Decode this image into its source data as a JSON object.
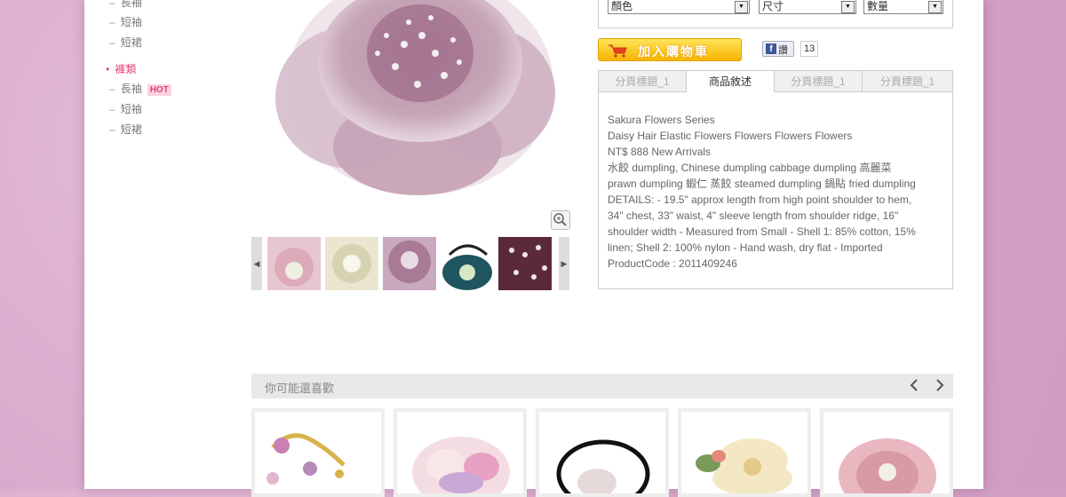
{
  "sidebar": {
    "items": [
      {
        "label": "長袖"
      },
      {
        "label": "短袖"
      },
      {
        "label": "短裙"
      }
    ],
    "category": {
      "label": "褲類"
    },
    "subitems": [
      {
        "label": "長袖",
        "badge": "HOT"
      },
      {
        "label": "短袖"
      },
      {
        "label": "短裙"
      }
    ]
  },
  "options": {
    "color": "顏色",
    "size": "尺寸",
    "qty": "數量"
  },
  "cart": {
    "label": "加入購物車"
  },
  "facebook": {
    "label": "讚",
    "count": "13"
  },
  "tabs": [
    {
      "label": "分頁標題_1"
    },
    {
      "label": "商品敘述"
    },
    {
      "label": "分頁標題_1"
    },
    {
      "label": "分頁標題_1"
    }
  ],
  "description": [
    "Sakura Flowers Series",
    "Daisy Hair Elastic Flowers Flowers Flowers Flowers",
    "NT$ 888 New Arrivals",
    "水餃 dumpling, Chinese dumpling cabbage dumpling 高麗菜",
    "prawn dumpling 蝦仁 蒸餃 steamed dumpling 鍋貼 fried dumpling",
    "DETAILS: - 19.5\" approx length from high point shoulder to hem,",
    "34\" chest, 33\" waist, 4\" sleeve length from shoulder ridge, 16\"",
    "shoulder width - Measured from Small - Shell 1: 85% cotton, 15%",
    "linen; Shell 2: 100% nylon - Hand wash, dry flat - Imported",
    "ProductCode : 2011409246"
  ],
  "related": {
    "title": "你可能還喜歡"
  },
  "colors": {
    "accent": "#e0457b",
    "cart": "#f7b400",
    "page_bg": "#d9a9cc"
  }
}
